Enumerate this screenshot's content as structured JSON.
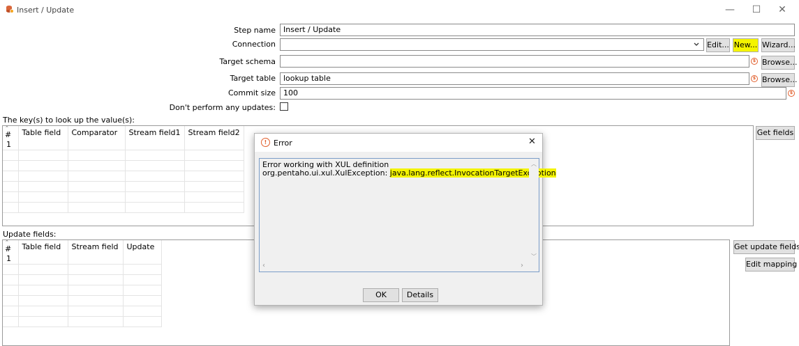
{
  "window": {
    "title": "Insert / Update",
    "minimize": "—",
    "maximize": "☐",
    "close": "✕"
  },
  "form": {
    "step_name_label": "Step name",
    "step_name_value": "Insert / Update",
    "connection_label": "Connection",
    "connection_value": "",
    "edit_button": "Edit...",
    "new_button": "New...",
    "wizard_button": "Wizard...",
    "target_schema_label": "Target schema",
    "target_schema_value": "",
    "browse_schema_button": "Browse...",
    "target_table_label": "Target table",
    "target_table_value": "lookup table",
    "browse_table_button": "Browse...",
    "commit_size_label": "Commit size",
    "commit_size_value": "100",
    "no_updates_label": "Don't perform any updates:",
    "no_updates_checked": false,
    "variable_icon_glyph": "$"
  },
  "keys_section": {
    "label": "The key(s) to look up the value(s):",
    "columns": [
      "#",
      "Table field",
      "Comparator",
      "Stream field1",
      "Stream field2"
    ],
    "first_row_number": "1",
    "get_fields_button": "Get fields"
  },
  "update_section": {
    "label": "Update fields:",
    "columns": [
      "#",
      "Table field",
      "Stream field",
      "Update"
    ],
    "first_row_number": "1",
    "get_update_fields_button": "Get update fields",
    "edit_mapping_button": "Edit mapping"
  },
  "error_dialog": {
    "title": "Error",
    "close": "✕",
    "icon_glyph": "!",
    "message_line1": "Error working with XUL definition",
    "message_line2_prefix": "org.pentaho.ui.xul.XulException: ",
    "message_line2_highlight": "java.lang.reflect.InvocationTargetException",
    "ok_button": "OK",
    "details_button": "Details"
  },
  "colors": {
    "highlight": "#f4f400",
    "variable_icon": "#e2602e",
    "error_icon": "#e2602e"
  }
}
